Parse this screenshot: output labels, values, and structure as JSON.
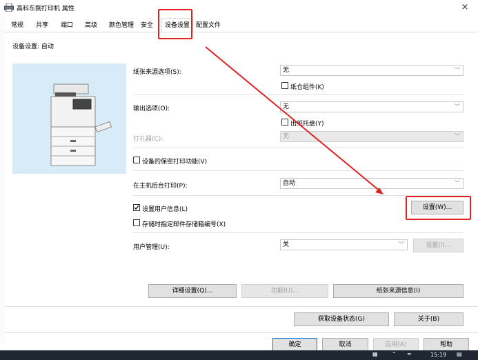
{
  "window": {
    "title": "高科东捌打印机 属性",
    "close": "×"
  },
  "tabs": [
    "常规",
    "共享",
    "端口",
    "高级",
    "颜色管理",
    "安全",
    "设备设置",
    "配置文件"
  ],
  "active_tab": "设备设置",
  "device_settings_label": "设备设置: 自动",
  "paper_source": {
    "label": "纸张来源选项(S):",
    "value": "无",
    "checkbox": "纸仓组件(K)"
  },
  "output": {
    "label": "输出选项(O):",
    "value": "无",
    "checkbox": "出纸托盘(Y)"
  },
  "puncher": {
    "label": "打孔器(C):",
    "value": "无"
  },
  "secure_print": {
    "checkbox": "设备的保密打印功能(V)"
  },
  "spool": {
    "label": "在主机后台打印(P):",
    "value": "自动"
  },
  "user_info": {
    "checkbox": "设置用户信息(L)",
    "checked": true,
    "button": "设置(W)..."
  },
  "mailbox": {
    "checkbox": "存储时指定邮件存储箱编号(X)"
  },
  "user_mgmt": {
    "label": "用户管理(U):",
    "value": "关",
    "button": "设置(I)..."
  },
  "actions": {
    "detail": "详细设置(Q)...",
    "function": "功能(U)...",
    "paper_info": "纸张来源信息(I)"
  },
  "status": {
    "get_status": "获取设备状态(G)",
    "about": "关于(B)"
  },
  "dialog": {
    "ok": "确定",
    "cancel": "取消",
    "apply": "应用(A)",
    "help": "帮助"
  },
  "taskbar": {
    "time": "15:19"
  },
  "colors": {
    "highlight": "#e02020",
    "arrow": "#e02020",
    "panel": "#d8ebf8"
  }
}
